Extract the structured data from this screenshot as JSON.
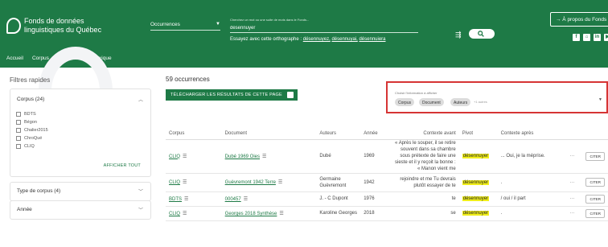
{
  "header": {
    "logo_line1": "Fonds de données",
    "logo_line2": "linguistiques du Québec",
    "search_type": "Occurrences",
    "search_hint": "Cherchez un mot ou une suite de mots dans le Fonds...",
    "search_value": "désennuyer",
    "suggest_prefix": "Essayez avec cette orthographe :",
    "suggestions": [
      "désennuyez,",
      "désennuyai,",
      "désennuiera"
    ],
    "apropos": "→ À propos du Fonds",
    "social": [
      "f",
      "⌂",
      "in",
      "▶"
    ]
  },
  "nav": [
    "Accueil",
    "Corpus",
    "Documents",
    "Lexique"
  ],
  "sidebar": {
    "title": "Filtres rapides",
    "corpus_panel": {
      "title": "Corpus (24)",
      "items": [
        "BDTS",
        "Bégon",
        "Chalier2015",
        "ChroQué",
        "CLIQ"
      ],
      "show_all": "AFFICHER TOUT"
    },
    "type_panel": {
      "title": "Type de corpus (4)"
    },
    "year_panel": {
      "title": "Année"
    }
  },
  "main": {
    "count": "59 occurrences",
    "download": "TÉLÉCHARGER LES RÉSULTATS DE CETTE PAGE",
    "selector": {
      "label": "Choisir l'information à afficher",
      "chips": [
        "Corpus",
        "Document",
        "Auteurs"
      ],
      "more": "+1 autres"
    }
  },
  "table": {
    "headers": [
      "Corpus",
      "Document",
      "Auteurs",
      "Année",
      "Contexte avant",
      "Pivot",
      "Contexte après",
      "",
      ""
    ],
    "rows": [
      {
        "corpus": "CLIQ",
        "document": "Dubé 1969 Oies",
        "author": "Dubé",
        "year": "1969",
        "before": "« Après le souper, il se retire souvent dans sa chambre sous prétexte de faire une sieste et il y reçoit la bonne : « Manon vient me",
        "pivot": "désennuyer",
        "after": "... Oui, je la méprise.",
        "cite": "CITER"
      },
      {
        "corpus": "CLIQ",
        "document": "Guèvremont 1942 Terre",
        "author": "Germaine Guèvremont",
        "year": "1942",
        "before": "rejoindre et me Tu devrais plutôt essayer de te",
        "pivot": "désennuyer",
        "after": ".",
        "cite": "CITER"
      },
      {
        "corpus": "BDTS",
        "document": "000457",
        "author": "J. - C Dupont",
        "year": "1976",
        "before": "te",
        "pivot": "désennuyer",
        "after": "/ oui / il part",
        "cite": "CITER"
      },
      {
        "corpus": "CLIQ",
        "document": "Georges 2018 Synthèse",
        "author": "Karoline Georges",
        "year": "2018",
        "before": "se",
        "pivot": "désennuyer",
        "after": ".",
        "cite": "CITER"
      }
    ]
  }
}
